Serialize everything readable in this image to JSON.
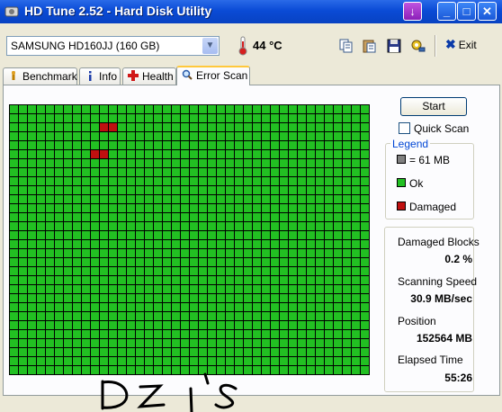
{
  "window": {
    "title": "HD Tune 2.52 - Hard Disk Utility"
  },
  "toolbar": {
    "drive": "SAMSUNG HD160JJ (160 GB)",
    "temperature": "44 °C",
    "exit_label": "Exit"
  },
  "tabs": [
    {
      "label": "Benchmark",
      "icon": "gauge-icon"
    },
    {
      "label": "Info",
      "icon": "info-icon"
    },
    {
      "label": "Health",
      "icon": "health-cross-icon"
    },
    {
      "label": "Error Scan",
      "icon": "magnifier-icon",
      "active": true
    }
  ],
  "scan": {
    "start_label": "Start",
    "quick_scan_label": "Quick Scan",
    "quick_scan_checked": false,
    "grid_columns": 40,
    "grid_rows": 30,
    "damaged_blocks": [
      [
        10,
        2
      ],
      [
        11,
        2
      ],
      [
        9,
        5
      ],
      [
        10,
        5
      ]
    ]
  },
  "legend": {
    "title": "Legend",
    "items": [
      {
        "label": "= 61 MB",
        "color": "#808080"
      },
      {
        "label": "Ok",
        "color": "#22c022"
      },
      {
        "label": "Damaged",
        "color": "#c01010"
      }
    ]
  },
  "stats": {
    "damaged_blocks_label": "Damaged Blocks",
    "damaged_blocks_value": "0.2 %",
    "scanning_speed_label": "Scanning Speed",
    "scanning_speed_value": "30.9 MB/sec",
    "position_label": "Position",
    "position_value": "152564 MB",
    "elapsed_label": "Elapsed Time",
    "elapsed_value": "55:26"
  },
  "colors": {
    "ok": "#22c022",
    "damaged": "#c01010",
    "grid_line": "#000000"
  },
  "signature": "Dzi's"
}
